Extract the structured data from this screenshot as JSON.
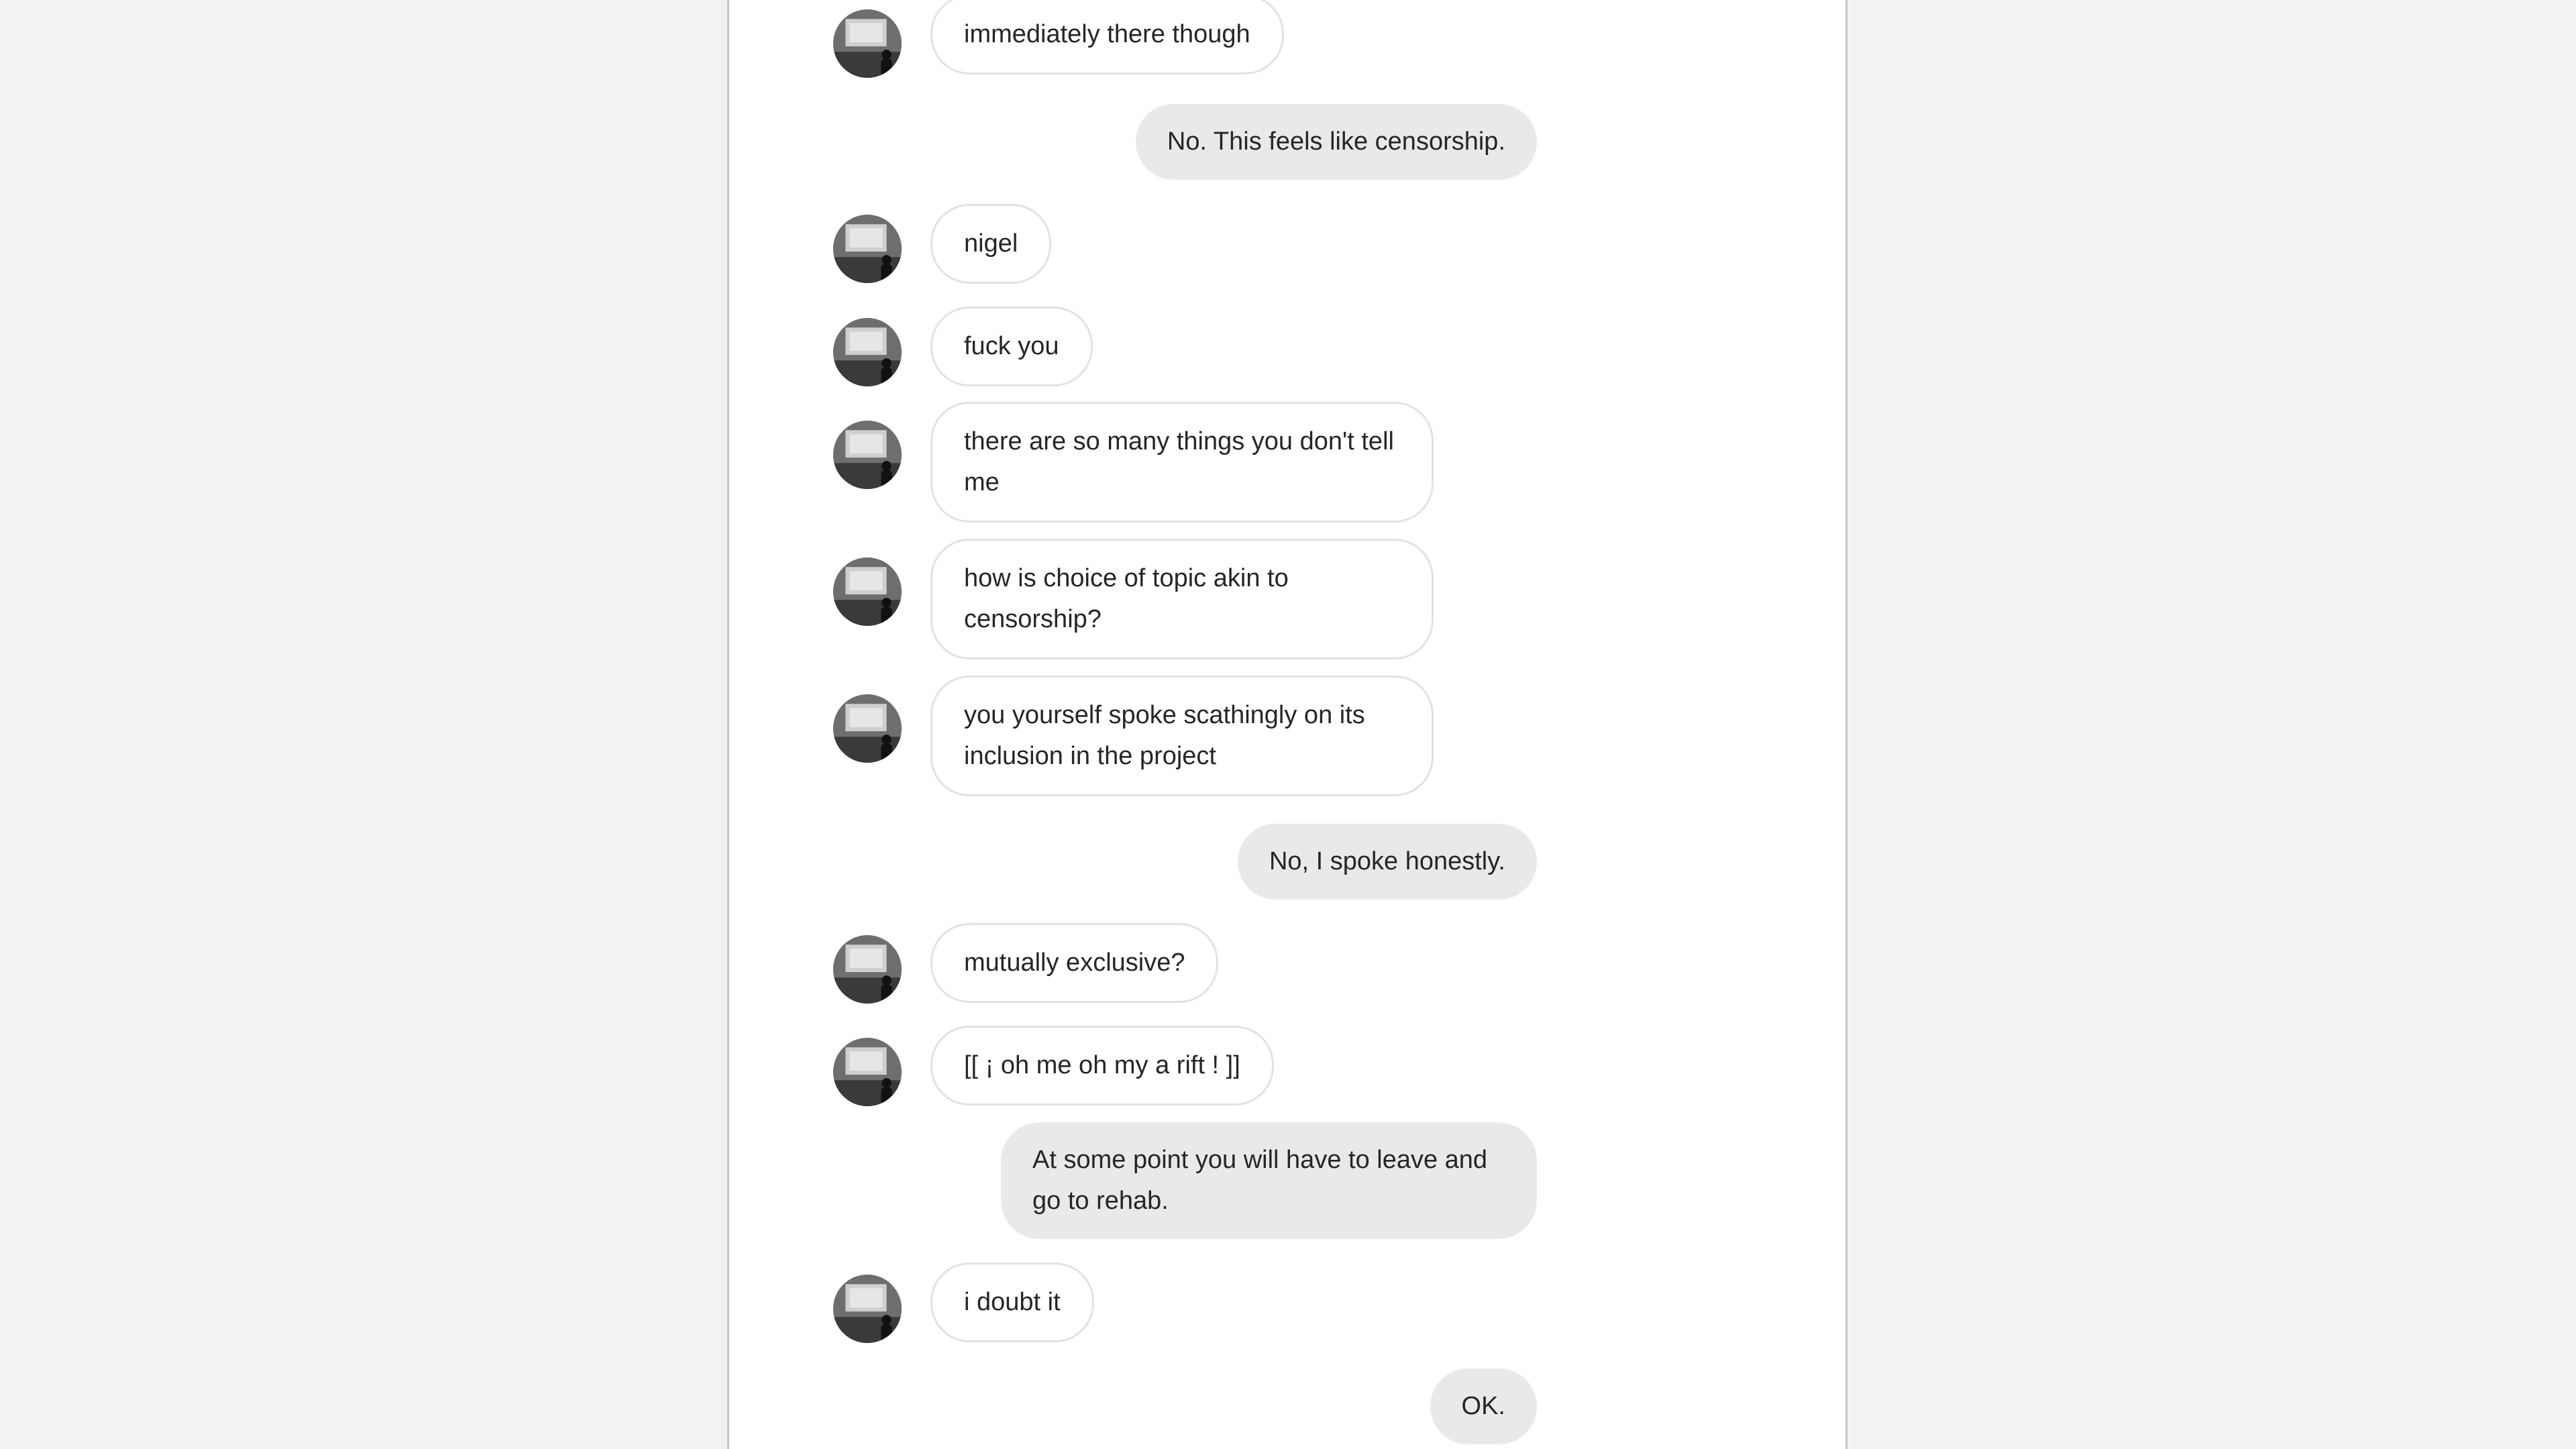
{
  "messages": [
    {
      "sender": "them",
      "text": "immediately there though"
    },
    {
      "sender": "me",
      "text": "No. This feels like censorship."
    },
    {
      "sender": "them",
      "text": "nigel"
    },
    {
      "sender": "them",
      "text": "fuck you"
    },
    {
      "sender": "them",
      "text": "there are so many things you don't tell me"
    },
    {
      "sender": "them",
      "text": "how is choice of topic akin to censorship?"
    },
    {
      "sender": "them",
      "text": "you yourself spoke scathingly on its inclusion in the project"
    },
    {
      "sender": "me",
      "text": "No, I spoke honestly."
    },
    {
      "sender": "them",
      "text": "mutually exclusive?"
    },
    {
      "sender": "them",
      "text": "[[ ¡ oh me oh my a rift ! ]]"
    },
    {
      "sender": "me",
      "text": "At some point you will have to leave and go to rehab."
    },
    {
      "sender": "them",
      "text": "i doubt it"
    },
    {
      "sender": "me",
      "text": "OK."
    }
  ],
  "avatar": {
    "icon": "person-silhouette-photo-avatar"
  }
}
